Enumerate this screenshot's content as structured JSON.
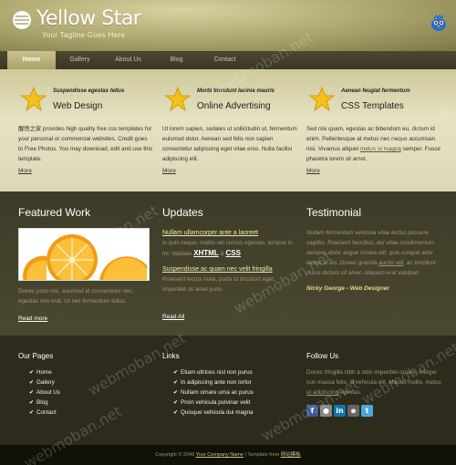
{
  "header": {
    "logo_title": "Yellow Star",
    "tagline": "Your Tagline Goes Here"
  },
  "nav": [
    {
      "label": "Home",
      "active": true
    },
    {
      "label": "Gallery"
    },
    {
      "label": "About Us"
    },
    {
      "label": "Blog"
    },
    {
      "label": "Contact"
    }
  ],
  "services": [
    {
      "kicker": "Suspendisse egestas tellus",
      "title": "Web Design",
      "text_a": "醒悟之家 provides high quality free css templates for your personal or commercial websites. Credit goes to Free Photos. You may download, edit and use this template.",
      "text_link": "",
      "text_b": "",
      "more": "More"
    },
    {
      "kicker": "Morbi tincidunt lacinia mauris",
      "title": "Online Advertising",
      "text_a": "Ut lorem sapien, sodales ut sollicitudin ut, fermentum euismod dolor. Aenean sed felis non sapien consectetur adipiscing eget vitae eros. Nulla facilisi adipiscing elit.",
      "text_link": "",
      "text_b": "",
      "more": "More"
    },
    {
      "kicker": "Aenean feugiat fermentum",
      "title": "CSS Templates",
      "text_a": "Sed nisi quam, egestas ac bibendum eu, dictum id enim. Pellentesque at metus nec neque accumsan nisi. Vivamus aliquet ",
      "text_link": "metus id magna",
      "text_b": " semper. Fusce pharetra lorem sit amet.",
      "more": "More"
    }
  ],
  "featured": {
    "heading": "Featured Work",
    "text": "Donec justo nisi, euismod id consectetur nec, egestas non erat. Ut nec fermentum tellus.",
    "readmore": "Read more"
  },
  "updates": {
    "heading": "Updates",
    "items": [
      {
        "title": "Nullam ullamcorper ante a laoreet",
        "text_a": "In quis neque, mattis vel cursus egestas, tempus in mi. Validate ",
        "xhtml": "XHTML",
        "amp": " & ",
        "css": "CSS"
      },
      {
        "title": "Suspendisse ac quam nec velit fringilla",
        "text_a": "Praesent lectus nulla, porta id tincidunt eget, imperdiet sit amet justo.",
        "xhtml": "",
        "amp": "",
        "css": ""
      }
    ],
    "readall": "Read All"
  },
  "testimonial": {
    "heading": "Testimonial",
    "quote_a": "Nullam fermentum vehicula vitae lectus posuere sagittis. Praesent faucibus, dui vitae condimentum semper, dolor augue ornare elit, quis congue ante lectus id dui. Donec gravida ",
    "quote_link": "auctor elit",
    "quote_b": ", ac tincidunt purus dictum sit amet. Aliquam erat volutpat.",
    "author_name": "Nicky George",
    "author_role": "Web Designer",
    "author_sep": " - "
  },
  "footer": {
    "pages": {
      "heading": "Our Pages",
      "items": [
        "Home",
        "Gallery",
        "About Us",
        "Blog",
        "Contact"
      ]
    },
    "links": {
      "heading": "Links",
      "items": [
        "Etiam ultrices nisl non purus",
        "In adipiscing ante non tortor",
        "Nullam ornare urna ac purus",
        "Proin vehicula pulvinar velit",
        "Quisque vehicula dui magna"
      ]
    },
    "follow": {
      "heading": "Follow Us",
      "text_a": "Donec fringilla nibh a odio imperdiet ornare. Integer non massa felis, id vehicula elit. Mauris mollis, metus ",
      "text_link": "ut adipiscing",
      "text_b": " egestas.",
      "icons": [
        "facebook-icon",
        "flickr-icon",
        "linkedin-icon",
        "myspace-icon",
        "twitter-icon"
      ]
    }
  },
  "bottom": {
    "copyright": "Copyright © 2048 ",
    "company": "Your Company Name",
    "sep": " | Template from ",
    "source": "网站模板"
  },
  "watermark": "webmoban.net",
  "colors": {
    "accent": "#c9c28c",
    "dark": "#3d3b27",
    "star": "#f2c21a"
  }
}
